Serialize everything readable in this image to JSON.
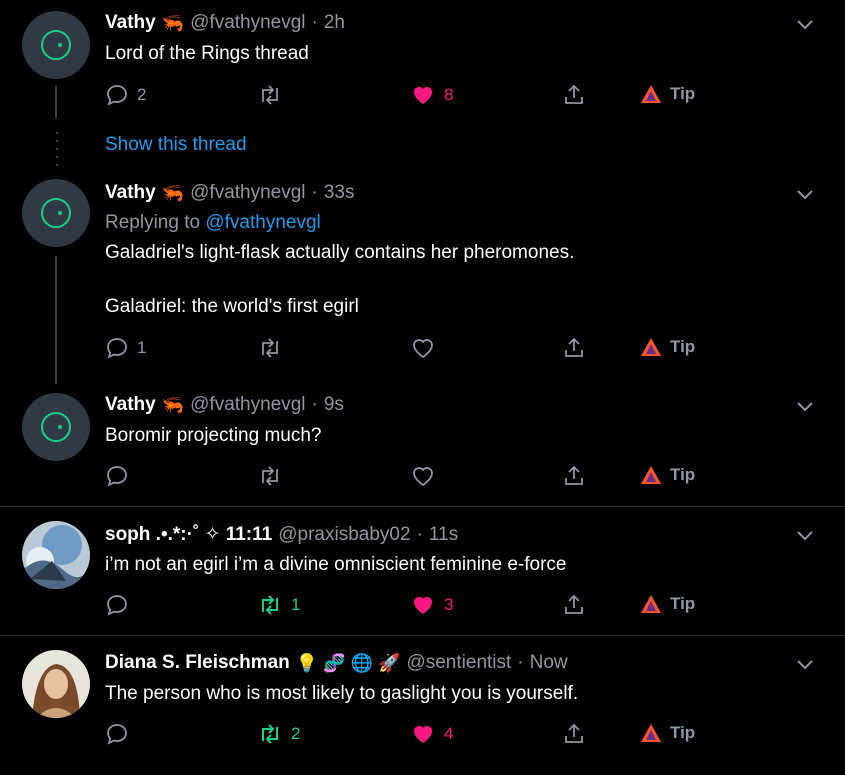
{
  "colors": {
    "background": "#000000",
    "link": "#1d9bf0",
    "muted": "#8b98a5",
    "retweet": "#19cf86",
    "like": "#f91880"
  },
  "show_thread": "Show this thread",
  "tip_label": "Tip",
  "tweets": [
    {
      "name": "Vathy",
      "name_emoji": "🦐",
      "handle": "@fvathynevgl",
      "dot": "·",
      "time": "2h",
      "text": "Lord of the Rings thread",
      "replies": "2",
      "retweets": "",
      "likes": "8",
      "liked": true
    },
    {
      "name": "Vathy",
      "name_emoji": "🦐",
      "handle": "@fvathynevgl",
      "dot": "·",
      "time": "33s",
      "replying_prefix": "Replying to",
      "replying_to": "@fvathynevgl",
      "text_line1": "Galadriel's light-flask actually contains her pheromones.",
      "text_line2": "Galadriel: the world's first egirl",
      "replies": "1",
      "retweets": "",
      "likes": "",
      "liked": false
    },
    {
      "name": "Vathy",
      "name_emoji": "🦐",
      "handle": "@fvathynevgl",
      "dot": "·",
      "time": "9s",
      "text": "Boromir projecting much?",
      "replies": "",
      "retweets": "",
      "likes": "",
      "liked": false
    },
    {
      "name": "soph .•.*:·˚ ✧ 11:11",
      "handle": "@praxisbaby02",
      "dot": "·",
      "time": "11s",
      "text": "i’m not an egirl i’m a divine omniscient feminine e-force",
      "replies": "",
      "retweets": "1",
      "likes": "3",
      "liked": true,
      "retweeted": true
    },
    {
      "name": "Diana S. Fleischman",
      "name_emojis": "💡 🧬 🌐 🚀",
      "handle": "@sentientist",
      "dot": "·",
      "time": "Now",
      "text": "The person who is most likely to gaslight you is yourself.",
      "replies": "",
      "retweets": "2",
      "likes": "4",
      "liked": true,
      "retweeted": true
    }
  ]
}
